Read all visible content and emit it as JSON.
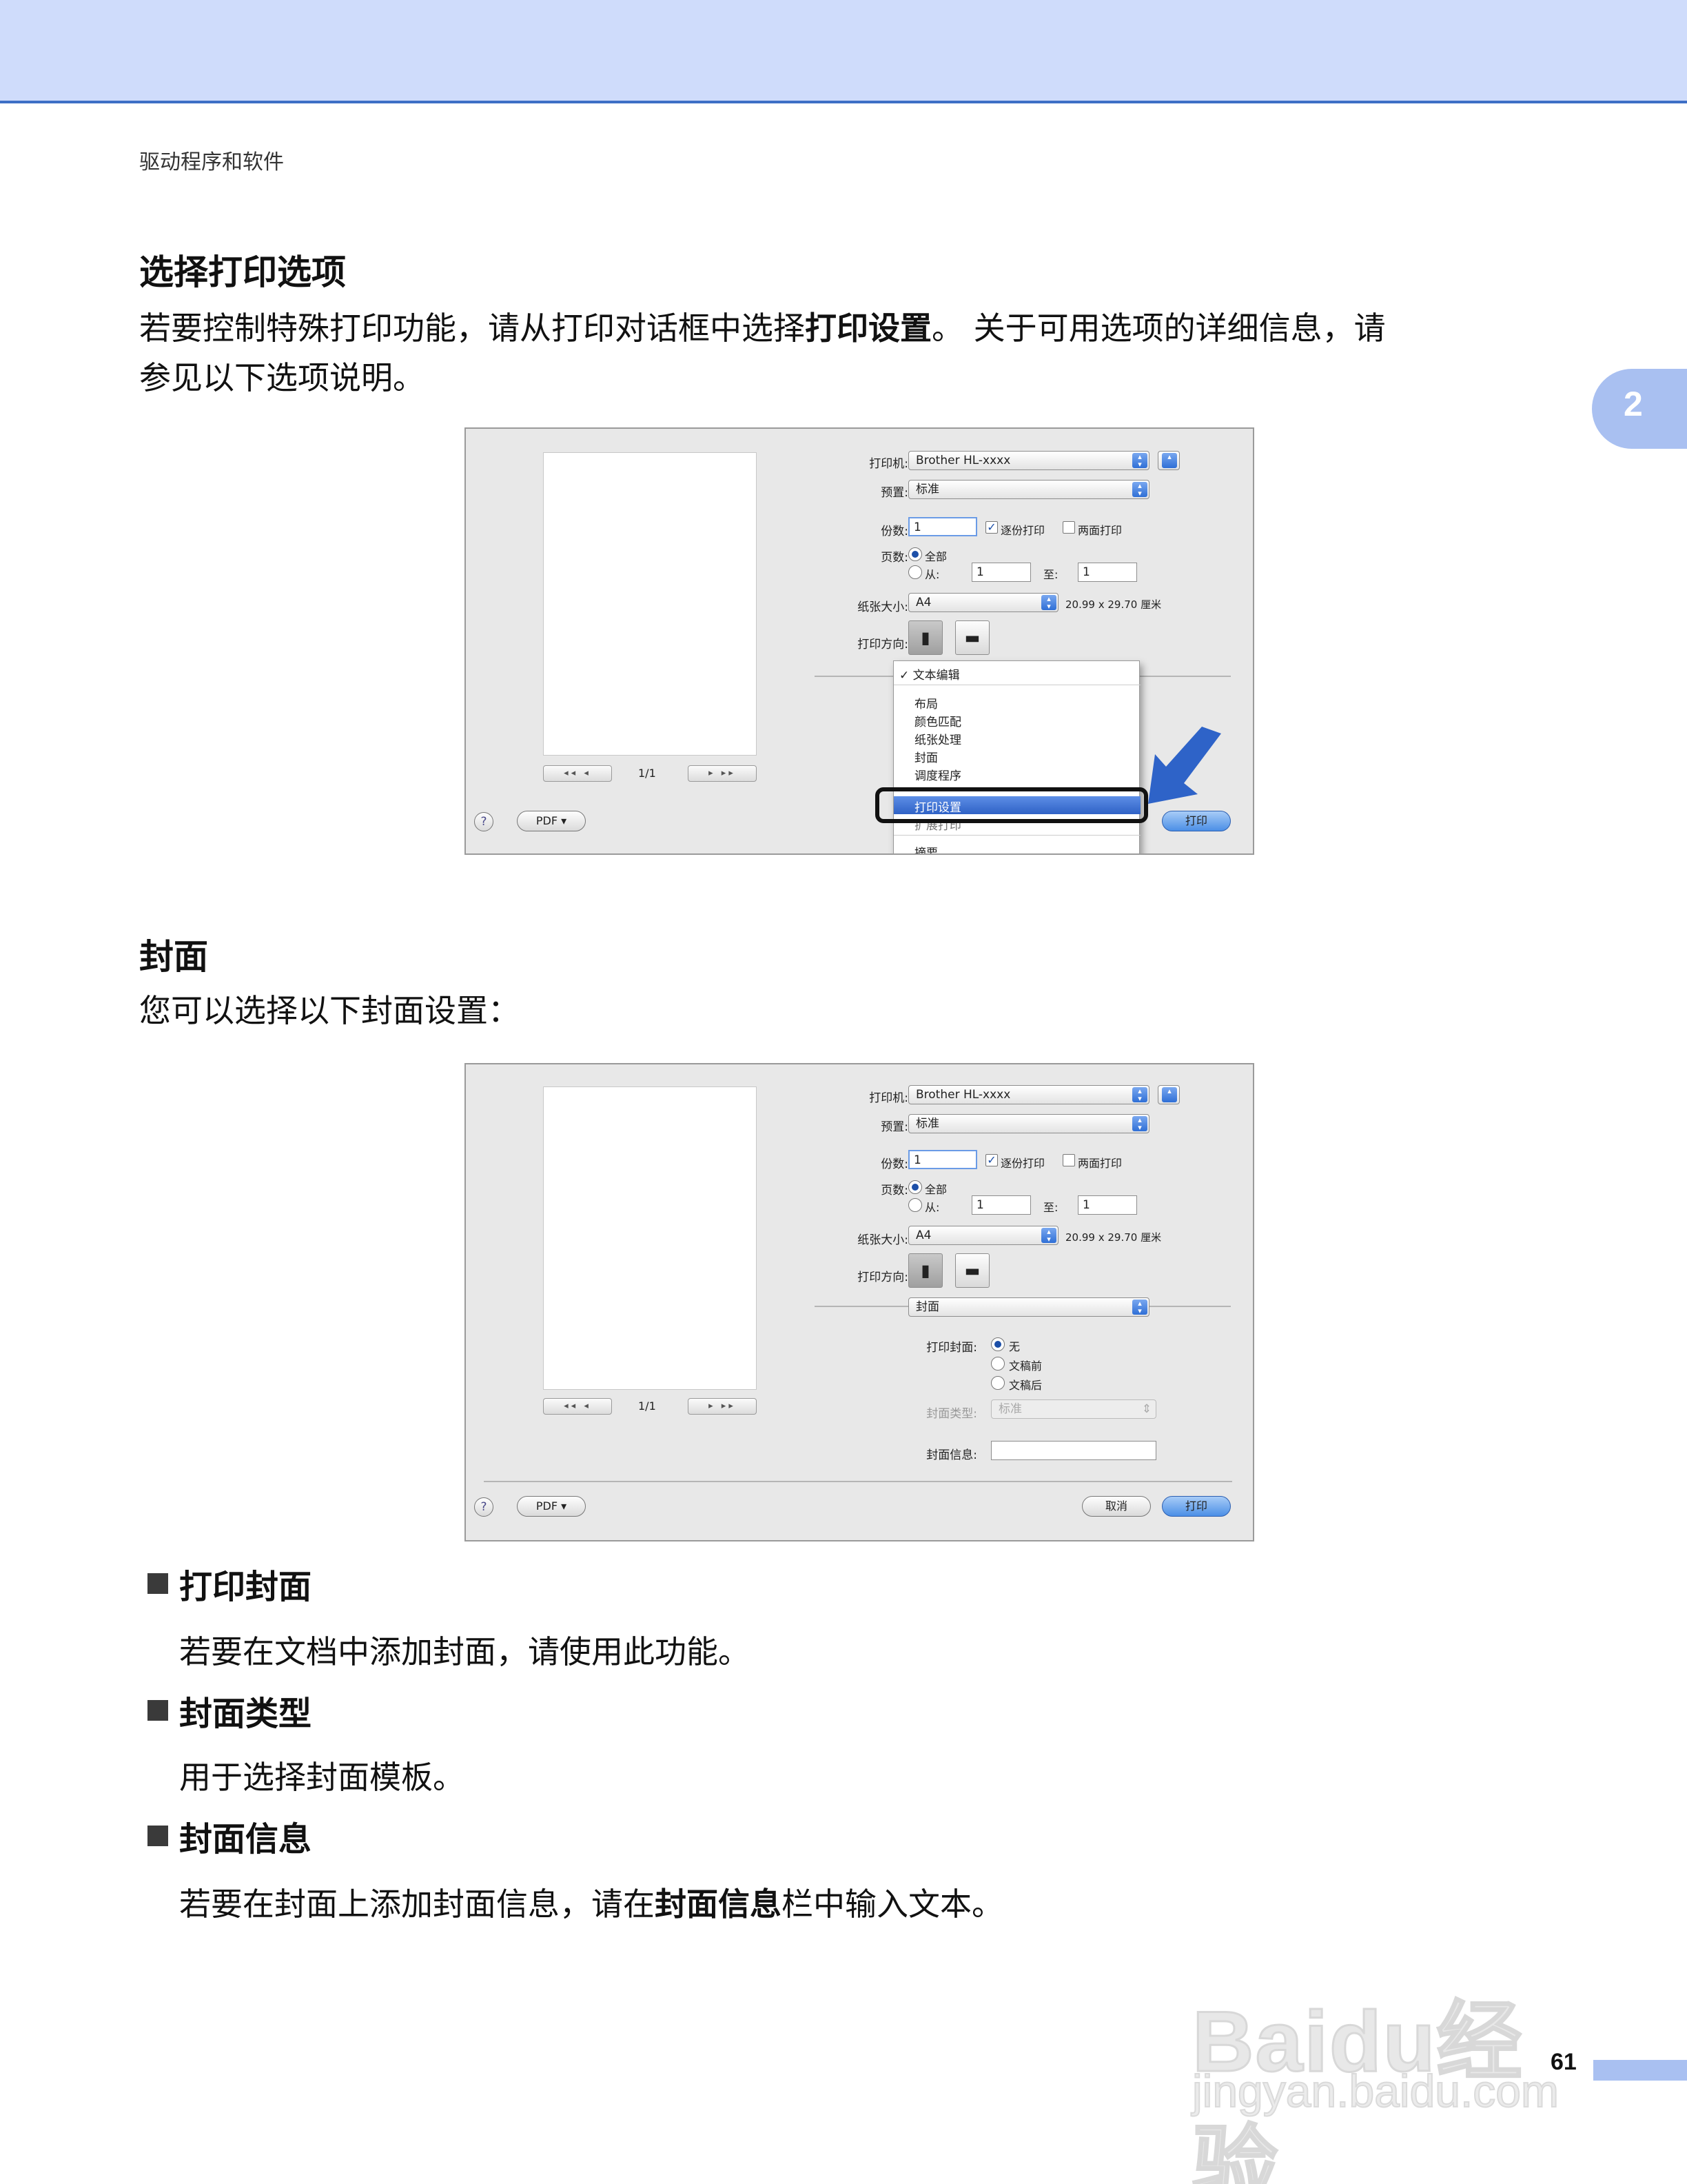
{
  "header": {
    "breadcrumb": "驱动程序和软件",
    "chapter_number": "2"
  },
  "section1": {
    "title": "选择打印选项",
    "para_part1": "若要控制特殊打印功能，请从打印对话框中选择",
    "para_bold": "打印设置",
    "para_part2": "。 关于可用选项的详细信息，请",
    "para_line2": "参见以下选项说明。"
  },
  "dialog1": {
    "printer_label": "打印机:",
    "printer_value": "Brother HL-xxxx",
    "preset_label": "预置:",
    "preset_value": "标准",
    "copies_label": "份数:",
    "copies_value": "1",
    "collate_label": "逐份打印",
    "collate_checked": true,
    "duplex_label": "两面打印",
    "duplex_checked": false,
    "pages_label": "页数:",
    "pages_all_label": "全部",
    "pages_from_label": "从:",
    "pages_from_value": "1",
    "pages_to_label": "至:",
    "pages_to_value": "1",
    "paper_size_label": "纸张大小:",
    "paper_size_value": "A4",
    "paper_dims": "20.99 x 29.70 厘米",
    "orientation_label": "打印方向:",
    "page_indicator": "1/1",
    "pdf_button": "PDF ▾",
    "print_button": "打印",
    "help_button": "?",
    "menu": {
      "checked_item": "文本编辑",
      "items": [
        "布局",
        "颜色匹配",
        "纸张处理",
        "封面",
        "调度程序"
      ],
      "highlighted": "打印设置",
      "after_highlight": "扩展打印",
      "last_item": "摘要"
    }
  },
  "section2": {
    "title": "封面",
    "para": "您可以选择以下封面设置："
  },
  "dialog2": {
    "printer_label": "打印机:",
    "printer_value": "Brother HL-xxxx",
    "preset_label": "预置:",
    "preset_value": "标准",
    "copies_label": "份数:",
    "copies_value": "1",
    "collate_label": "逐份打印",
    "duplex_label": "两面打印",
    "pages_label": "页数:",
    "pages_all_label": "全部",
    "pages_from_label": "从:",
    "pages_from_value": "1",
    "pages_to_label": "至:",
    "pages_to_value": "1",
    "paper_size_label": "纸张大小:",
    "paper_size_value": "A4",
    "paper_dims": "20.99 x 29.70 厘米",
    "orientation_label": "打印方向:",
    "panel_value": "封面",
    "print_cover_label": "打印封面:",
    "cover_options": [
      "无",
      "文稿前",
      "文稿后"
    ],
    "cover_selected": "无",
    "cover_type_label": "封面类型:",
    "cover_type_value": "标准",
    "cover_info_label": "封面信息:",
    "cover_info_value": "",
    "page_indicator": "1/1",
    "pdf_button": "PDF ▾",
    "cancel_button": "取消",
    "print_button": "打印",
    "help_button": "?"
  },
  "bullets": [
    {
      "title": "打印封面",
      "desc": "若要在文档中添加封面，请使用此功能。"
    },
    {
      "title": "封面类型",
      "desc": "用于选择封面模板。"
    },
    {
      "title": "封面信息",
      "desc_part1": "若要在封面上添加封面信息，请在",
      "desc_bold": "封面信息",
      "desc_part2": "栏中输入文本。"
    }
  ],
  "footer": {
    "page_number": "61",
    "watermark_logo": "Baidu经验",
    "watermark_url": "jingyan.baidu.com"
  },
  "colors": {
    "header_band": "#cfdcfb",
    "header_rule": "#3e6fc6",
    "chapter_tab": "#a9c0f1",
    "menu_highlight": "#2f62c6",
    "callout_arrow": "#2e63c8"
  }
}
